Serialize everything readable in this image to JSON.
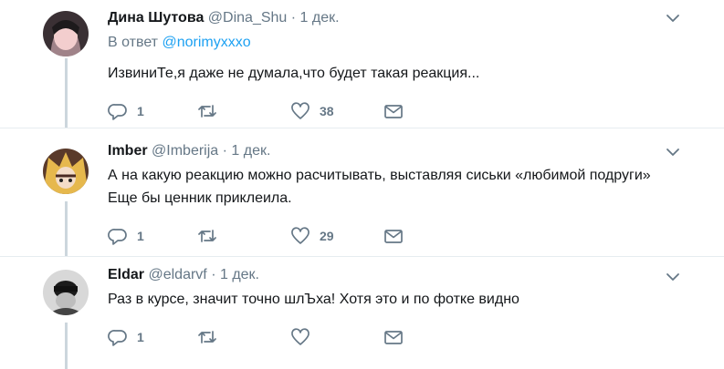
{
  "tweets": [
    {
      "name": "Дина Шутова",
      "handle": "@Dina_Shu",
      "dot": "·",
      "time": "1 дек.",
      "reply_prefix": "В ответ",
      "reply_to": "@norimyxxxo",
      "text": "ИзвиниТе,я даже не думала,что будет такая реакция...",
      "replies": "1",
      "retweets": "",
      "likes": "38"
    },
    {
      "name": "Imber",
      "handle": "@Imberija",
      "dot": "·",
      "time": "1 дек.",
      "text": "А на какую реакцию можно расчитывать, выставляя сиськи «любимой подруги» Еще бы ценник приклеила.",
      "replies": "1",
      "retweets": "",
      "likes": "29"
    },
    {
      "name": "Eldar",
      "handle": "@eldarvf",
      "dot": "·",
      "time": "1 дек.",
      "text": "Раз в курсе, значит точно шлЪха! Хотя это и по фотке видно",
      "replies": "1",
      "retweets": "",
      "likes": ""
    }
  ],
  "icons": {
    "reply": "reply-icon",
    "retweet": "retweet-icon",
    "like": "heart-icon",
    "dm": "envelope-icon",
    "more": "chevron-down-icon"
  },
  "colors": {
    "link": "#1da1f2",
    "muted": "#657786",
    "thread_line": "#ccd6dd"
  }
}
